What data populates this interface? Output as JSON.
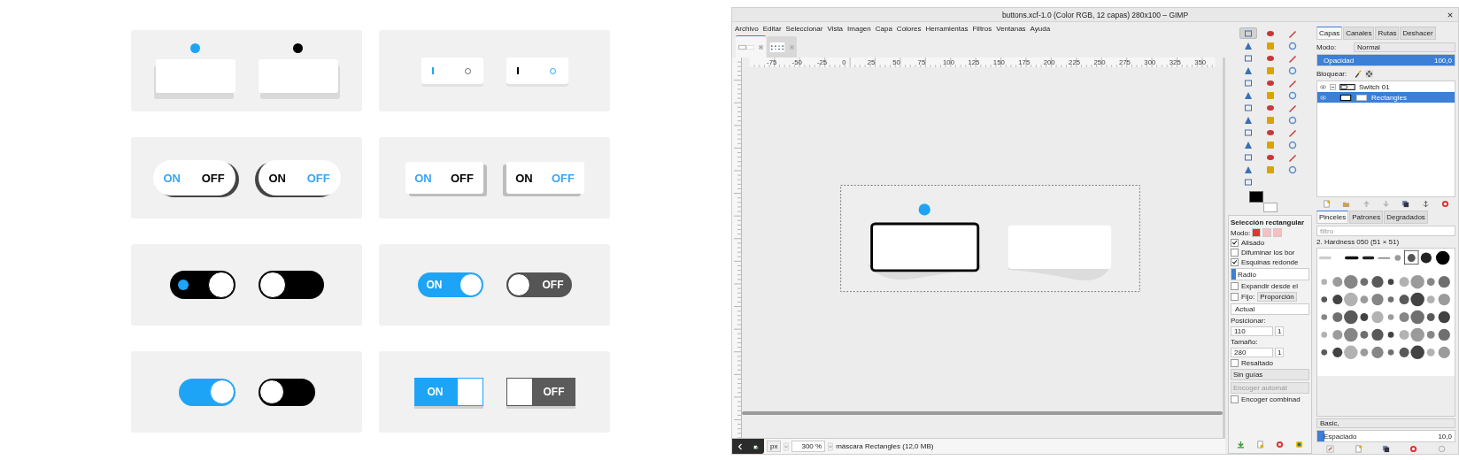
{
  "showcase": {
    "cards": [
      {
        "kind": "rocker",
        "switches": [
          {
            "on": true
          },
          {
            "on": false
          }
        ]
      },
      {
        "kind": "rocker_small",
        "switches": [
          {
            "on": true
          },
          {
            "on": false
          }
        ]
      },
      {
        "kind": "pill_text",
        "switches": [
          {
            "on": true,
            "labels": [
              "ON",
              "OFF"
            ]
          },
          {
            "on": false,
            "labels": [
              "ON",
              "OFF"
            ]
          }
        ]
      },
      {
        "kind": "rocker_text",
        "switches": [
          {
            "on": true,
            "labels": [
              "ON",
              "OFF"
            ]
          },
          {
            "on": false,
            "labels": [
              "ON",
              "OFF"
            ]
          }
        ]
      },
      {
        "kind": "knob_dark",
        "switches": [
          {
            "on": true
          },
          {
            "on": false
          }
        ]
      },
      {
        "kind": "knob_label",
        "switches": [
          {
            "on": true,
            "label": "ON"
          },
          {
            "on": false,
            "label": "OFF"
          }
        ]
      },
      {
        "kind": "knob_plain",
        "switches": [
          {
            "on": true
          },
          {
            "on": false
          }
        ]
      },
      {
        "kind": "square",
        "switches": [
          {
            "on": true,
            "label": "ON"
          },
          {
            "on": false,
            "label": "OFF"
          }
        ]
      }
    ]
  },
  "gimp": {
    "title": "buttons.xcf-1.0 (Color RGB, 12 capas) 280x100 – GIMP",
    "menu": [
      "Archivo",
      "Editar",
      "Seleccionar",
      "Vista",
      "Imagen",
      "Capa",
      "Colores",
      "Herramientas",
      "Filtros",
      "Ventanas",
      "Ayuda"
    ],
    "image_tabs": [
      {
        "selected": true
      },
      {
        "selected": false
      }
    ],
    "ruler_labels": [
      "-75",
      "-50",
      "-25",
      "0",
      "25",
      "50",
      "75",
      "100",
      "125",
      "150",
      "175",
      "200",
      "225",
      "250",
      "275",
      "300",
      "325",
      "350"
    ],
    "tools": [
      {
        "selected": true
      },
      {
        "selected": false
      },
      {
        "selected": false
      },
      {
        "selected": false
      },
      {
        "selected": false
      },
      {
        "selected": false
      },
      {
        "selected": false
      },
      {
        "selected": false
      },
      {
        "selected": false
      },
      {
        "selected": false
      },
      {
        "selected": false
      },
      {
        "selected": false
      },
      {
        "selected": false
      },
      {
        "selected": false
      },
      {
        "selected": false
      },
      {
        "selected": false
      },
      {
        "selected": false
      },
      {
        "selected": false
      },
      {
        "selected": false
      },
      {
        "selected": false
      },
      {
        "selected": false
      },
      {
        "selected": false
      },
      {
        "selected": false
      },
      {
        "selected": false
      },
      {
        "selected": false
      },
      {
        "selected": false
      },
      {
        "selected": false
      },
      {
        "selected": false
      },
      {
        "selected": false
      },
      {
        "selected": false
      },
      {
        "selected": false
      },
      {
        "selected": false
      },
      {
        "selected": false
      },
      {
        "selected": false
      },
      {
        "selected": false
      },
      {
        "selected": false
      },
      {
        "selected": false
      }
    ],
    "tool_options": {
      "title": "Selección rectangular",
      "mode_label": "Modo:",
      "rows": [
        {
          "kind": "check",
          "label": "Alisado",
          "checked": true
        },
        {
          "kind": "check",
          "label": "Difuminar los bor",
          "checked": false
        },
        {
          "kind": "check",
          "label": "Esquinas redonde",
          "checked": true
        },
        {
          "kind": "slider",
          "label": "Radio",
          "level": 0.06
        },
        {
          "kind": "check",
          "label": "Expandir desde el",
          "checked": false
        },
        {
          "kind": "check_combo",
          "label": "Fijo:",
          "checked": false,
          "value": "Proporción"
        },
        {
          "kind": "field",
          "value": "Actual"
        },
        {
          "kind": "label",
          "label": "Posicionar:"
        },
        {
          "kind": "spin",
          "value": "110",
          "second": "1"
        },
        {
          "kind": "label",
          "label": "Tamaño:"
        },
        {
          "kind": "spin",
          "value": "280",
          "second": "1"
        },
        {
          "kind": "check",
          "label": "Resaltado",
          "checked": false
        },
        {
          "kind": "dropdown",
          "value": "Sin guías"
        },
        {
          "kind": "button",
          "label": "Encoger automát",
          "disabled": true
        },
        {
          "kind": "check",
          "label": "Encoger combinad",
          "checked": false
        }
      ]
    },
    "layers_dock": {
      "tabs": [
        {
          "label": "Capas",
          "selected": true
        },
        {
          "label": "Canales",
          "selected": false
        },
        {
          "label": "Rutas",
          "selected": false
        },
        {
          "label": "Deshacer",
          "selected": false
        }
      ],
      "mode_label": "Modo:",
      "mode": "Normal",
      "opacity": {
        "label": "Opacidad",
        "reading": "100,0",
        "level": 1
      },
      "lock_label": "Bloquear:",
      "layers": [
        {
          "name": "Switch 01",
          "visible": true,
          "selected": false,
          "expanded": true,
          "children": [
            {
              "name": "Rectangles",
              "visible": true,
              "selected": true
            }
          ]
        }
      ]
    },
    "brushes_dock": {
      "tabs": [
        {
          "label": "Pinceles",
          "selected": true
        },
        {
          "label": "Patrones",
          "selected": false
        },
        {
          "label": "Degradados",
          "selected": false
        }
      ],
      "filter_placeholder": "filtro",
      "brush_name": "2. Hardness 050 (51 × 51)",
      "preset": "Basic,",
      "spacing": {
        "label": "Espaciado",
        "reading": "10,0",
        "level": 0.05
      }
    },
    "status": {
      "unit": "px",
      "zoom": "300 %",
      "message": "máscara Rectangles (12,0 MB)"
    }
  }
}
